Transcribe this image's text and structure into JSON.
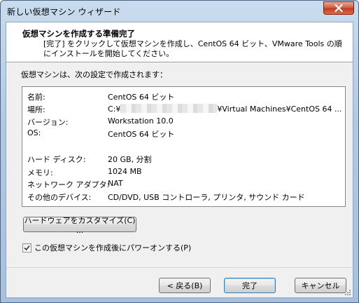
{
  "window": {
    "title": "新しい仮想マシン ウィザード"
  },
  "header": {
    "title": "仮想マシンを作成する準備完了",
    "description": "[完了] をクリックして仮想マシンを作成し、CentOS 64 ビット、VMware Tools の順にインストールを開始してください。"
  },
  "intro": "仮想マシンは、次の設定で作成されます：",
  "settings": [
    {
      "label": "名前:",
      "value": "CentOS 64 ビット"
    },
    {
      "label": "場所:",
      "value_prefix": "C:¥",
      "value_suffix": "¥Virtual Machines¥CentOS 64 ..."
    },
    {
      "label": "バージョン:",
      "value": "Workstation 10.0"
    },
    {
      "label": "OS:",
      "value": "CentOS 64 ビット"
    },
    {
      "label": "ハード ディスク:",
      "value": "20 GB, 分割"
    },
    {
      "label": "メモリ:",
      "value": "1024 MB"
    },
    {
      "label": "ネットワーク アダプタ:",
      "value": "NAT"
    },
    {
      "label": "その他のデバイス:",
      "value": "CD/DVD, USB コントローラ, プリンタ, サウンド カード"
    }
  ],
  "buttons": {
    "customize_hw": "ハードウェアをカスタマイズ(C) ...",
    "back": "< 戻る(B)",
    "finish": "完了",
    "cancel": "キャンセル"
  },
  "power_on": {
    "label": "この仮想マシンを作成後にパワーオンする(P)",
    "checked": true
  },
  "colors": {
    "close_button": "#c13b1a",
    "title_bar": "#b3c9e2",
    "default_button_border": "#3c7fb1"
  }
}
